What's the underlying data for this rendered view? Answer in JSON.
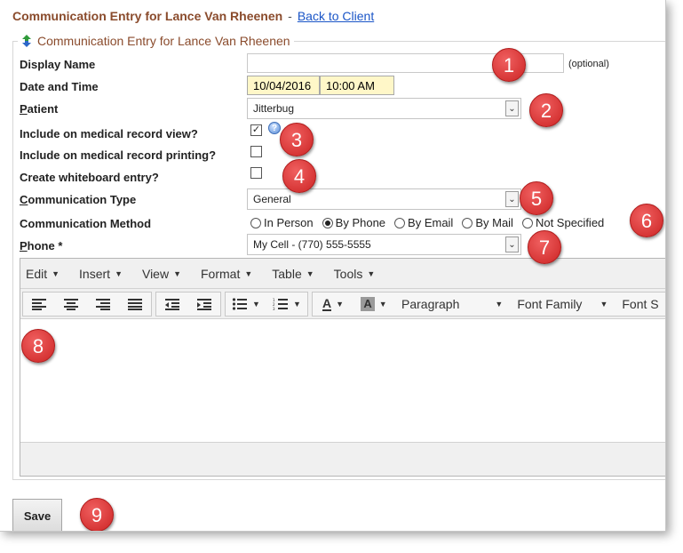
{
  "header": {
    "title": "Communication Entry for Lance Van Rheenen",
    "separator": "-",
    "back_link": "Back to Client"
  },
  "form": {
    "legend": "Communication Entry for Lance Van Rheenen",
    "display_name": {
      "label": "Display Name",
      "value": "",
      "hint": "(optional)"
    },
    "date_time": {
      "label": "Date and Time",
      "date": "10/04/2016",
      "time": "10:00 AM"
    },
    "patient": {
      "label_first": "P",
      "label_rest": "atient",
      "value": "Jitterbug"
    },
    "include_record_view": {
      "label": "Include on medical record view?",
      "checked": true,
      "check_mark": "✓"
    },
    "include_record_printing": {
      "label": "Include on medical record printing?",
      "checked": false
    },
    "whiteboard": {
      "label": "Create whiteboard entry?",
      "checked": false
    },
    "comm_type": {
      "label_first": "C",
      "label_rest": "ommunication Type",
      "value": "General"
    },
    "comm_method": {
      "label": "Communication Method",
      "options": [
        "In Person",
        "By Phone",
        "By Email",
        "By Mail",
        "Not Specified"
      ],
      "selected": "By Phone"
    },
    "phone": {
      "label_first": "P",
      "label_rest": "hone *",
      "value": "My Cell - (770) 555-5555"
    }
  },
  "editor": {
    "menus": [
      "Edit",
      "Insert",
      "View",
      "Format",
      "Table",
      "Tools"
    ],
    "format_dropdowns": [
      "Paragraph",
      "Font Family",
      "Font S"
    ],
    "text_color_glyph": "A",
    "bg_color_glyph": "A"
  },
  "save_label": "Save",
  "markers": [
    "1",
    "2",
    "3",
    "4",
    "5",
    "6",
    "7",
    "8",
    "9"
  ],
  "icons": {
    "select_arrow": "chevron-down-icon",
    "legend": "up-down-arrows-icon",
    "help": "question-mark-icon"
  },
  "colors": {
    "title": "#8a4b2c",
    "link": "#1a55c7",
    "marker": "#d42b2b",
    "highlight_input": "#fff7c8"
  }
}
